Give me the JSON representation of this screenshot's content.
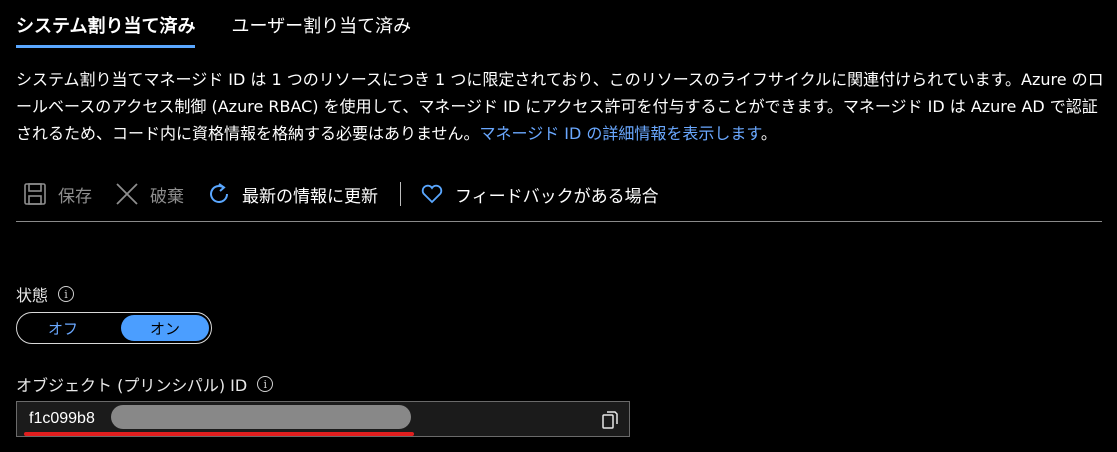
{
  "tabs": [
    {
      "label": "システム割り当て済み",
      "active": true
    },
    {
      "label": "ユーザー割り当て済み",
      "active": false
    }
  ],
  "description": {
    "text": "システム割り当てマネージド ID は 1 つのリソースにつき 1 つに限定されており、このリソースのライフサイクルに関連付けられています。Azure のロールベースのアクセス制御 (Azure RBAC) を使用して、マネージド ID にアクセス許可を付与することができます。マネージド ID は Azure AD で認証されるため、コード内に資格情報を格納する必要はありません。",
    "link": "マネージド ID の詳細情報を表示します",
    "end": "。"
  },
  "toolbar": {
    "save": "保存",
    "discard": "破棄",
    "refresh": "最新の情報に更新",
    "feedback": "フィードバックがある場合"
  },
  "status": {
    "label": "状態",
    "off": "オフ",
    "on": "オン",
    "selected": "オン"
  },
  "object_id": {
    "label": "オブジェクト (プリンシパル) ID",
    "value_visible": "f1c099b8"
  },
  "colors": {
    "accent": "#4b9eff",
    "link": "#6aa8ff",
    "underline": "#e01e1e"
  }
}
